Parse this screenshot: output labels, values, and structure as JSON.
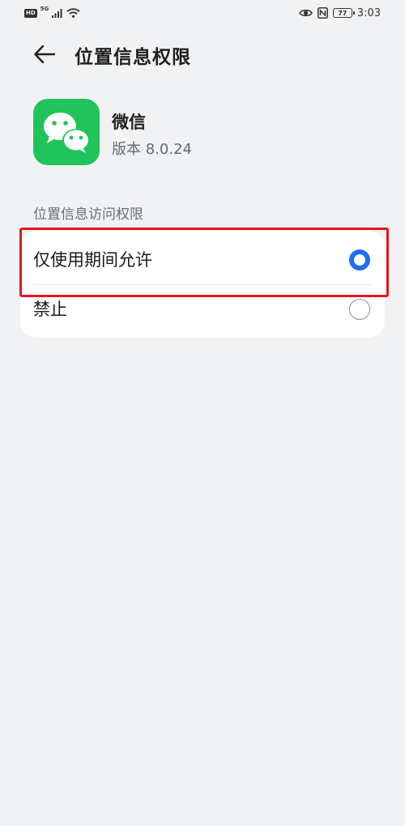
{
  "status_bar": {
    "hd_badge": "HD",
    "network": "5G",
    "battery": "77",
    "time": "3:03",
    "icons": [
      "signal-icon",
      "wifi-icon",
      "eye-icon",
      "nfc-icon",
      "battery-icon"
    ]
  },
  "header": {
    "back_icon": "arrow-left-icon",
    "title": "位置信息权限"
  },
  "app": {
    "icon": "wechat-icon",
    "name": "微信",
    "version": "版本 8.0.24",
    "icon_color": "#21c45a"
  },
  "section": {
    "label": "位置信息访问权限"
  },
  "options": [
    {
      "label": "仅使用期间允许",
      "selected": true
    },
    {
      "label": "禁止",
      "selected": false
    }
  ],
  "colors": {
    "accent": "#1f6ef2",
    "highlight": "#e0181f",
    "background": "#f1f2f4"
  }
}
